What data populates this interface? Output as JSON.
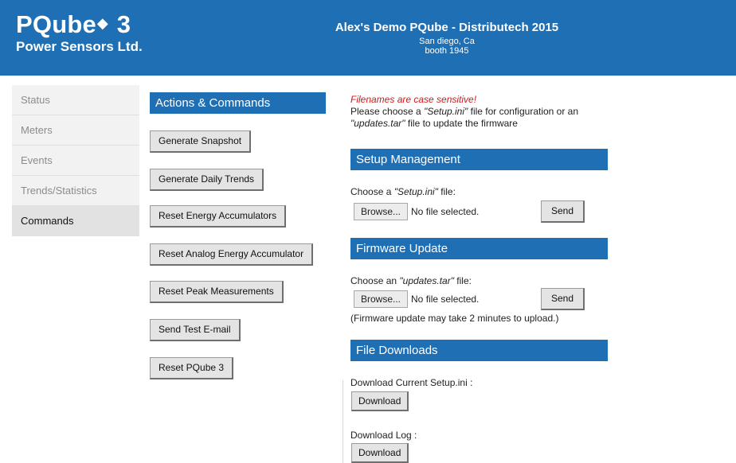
{
  "header": {
    "logo_name": "PQube",
    "logo_mark": "◆",
    "logo_suffix": "3",
    "company": "Power Sensors Ltd.",
    "title": "Alex's Demo PQube - Distributech 2015",
    "location": "San diego, Ca",
    "booth": "booth 1945",
    "colors": {
      "header_bg": "#1f6fb5",
      "section_bg": "#1f6fb5",
      "warning": "#d01818"
    }
  },
  "sidebar": {
    "items": [
      {
        "label": "Status",
        "active": false
      },
      {
        "label": "Meters",
        "active": false
      },
      {
        "label": "Events",
        "active": false
      },
      {
        "label": "Trends/Statistics",
        "active": false
      },
      {
        "label": "Commands",
        "active": true
      }
    ]
  },
  "actions": {
    "heading": "Actions & Commands",
    "buttons": [
      "Generate Snapshot",
      "Generate Daily Trends",
      "Reset Energy Accumulators",
      "Reset Analog Energy Accumulator",
      "Reset Peak Measurements",
      "Send Test E-mail",
      "Reset PQube 3"
    ]
  },
  "info": {
    "warning": "Filenames are case sensitive!",
    "line1_prefix": "Please choose a ",
    "line1_file": "\"Setup.ini\"",
    "line1_suffix": " file for configuration or an",
    "line2_file": "\"updates.tar\"",
    "line2_suffix": " file to update the firmware"
  },
  "setup": {
    "heading": "Setup Management",
    "choose_prefix": "Choose a ",
    "choose_file": "\"Setup.ini\"",
    "choose_suffix": " file:",
    "browse_label": "Browse...",
    "file_status": "No file selected.",
    "send_label": "Send"
  },
  "firmware": {
    "heading": "Firmware Update",
    "choose_prefix": "Choose an ",
    "choose_file": "\"updates.tar\"",
    "choose_suffix": " file:",
    "browse_label": "Browse...",
    "file_status": "No file selected.",
    "send_label": "Send",
    "note": "(Firmware update may take 2 minutes to upload.)"
  },
  "downloads": {
    "heading": "File Downloads",
    "setup_label": "Download Current Setup.ini :",
    "setup_button": "Download",
    "log_label": "Download Log :",
    "log_button": "Download"
  }
}
